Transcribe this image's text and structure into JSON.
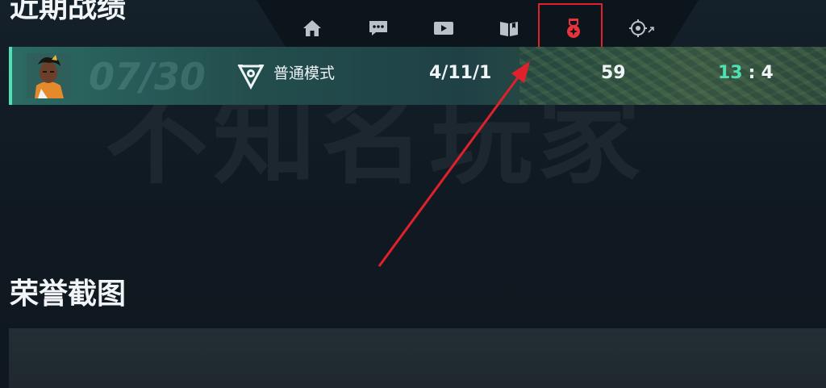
{
  "sections": {
    "recent_title": "近期战绩",
    "honor_title": "荣誉截图"
  },
  "watermark": "不知名玩家",
  "nav": {
    "items": [
      {
        "name": "home",
        "icon": "home-icon",
        "active": false
      },
      {
        "name": "chat",
        "icon": "chat-bubble-icon",
        "active": false
      },
      {
        "name": "video",
        "icon": "play-video-icon",
        "active": false
      },
      {
        "name": "guide",
        "icon": "book-icon",
        "active": false
      },
      {
        "name": "honor",
        "icon": "medal-icon",
        "active": true
      },
      {
        "name": "aim",
        "icon": "crosshair-external-icon",
        "active": false
      }
    ],
    "active_color": "#e8323e",
    "inactive_color": "#b9c2c8"
  },
  "match": {
    "date": "07/30",
    "mode": "普通模式",
    "kda": "4/11/1",
    "score": "59",
    "result_win": "13",
    "result_sep": ":",
    "result_loss": "4",
    "accent": "#4fe0b3"
  },
  "annotation": {
    "highlight_color": "#e0212b"
  }
}
